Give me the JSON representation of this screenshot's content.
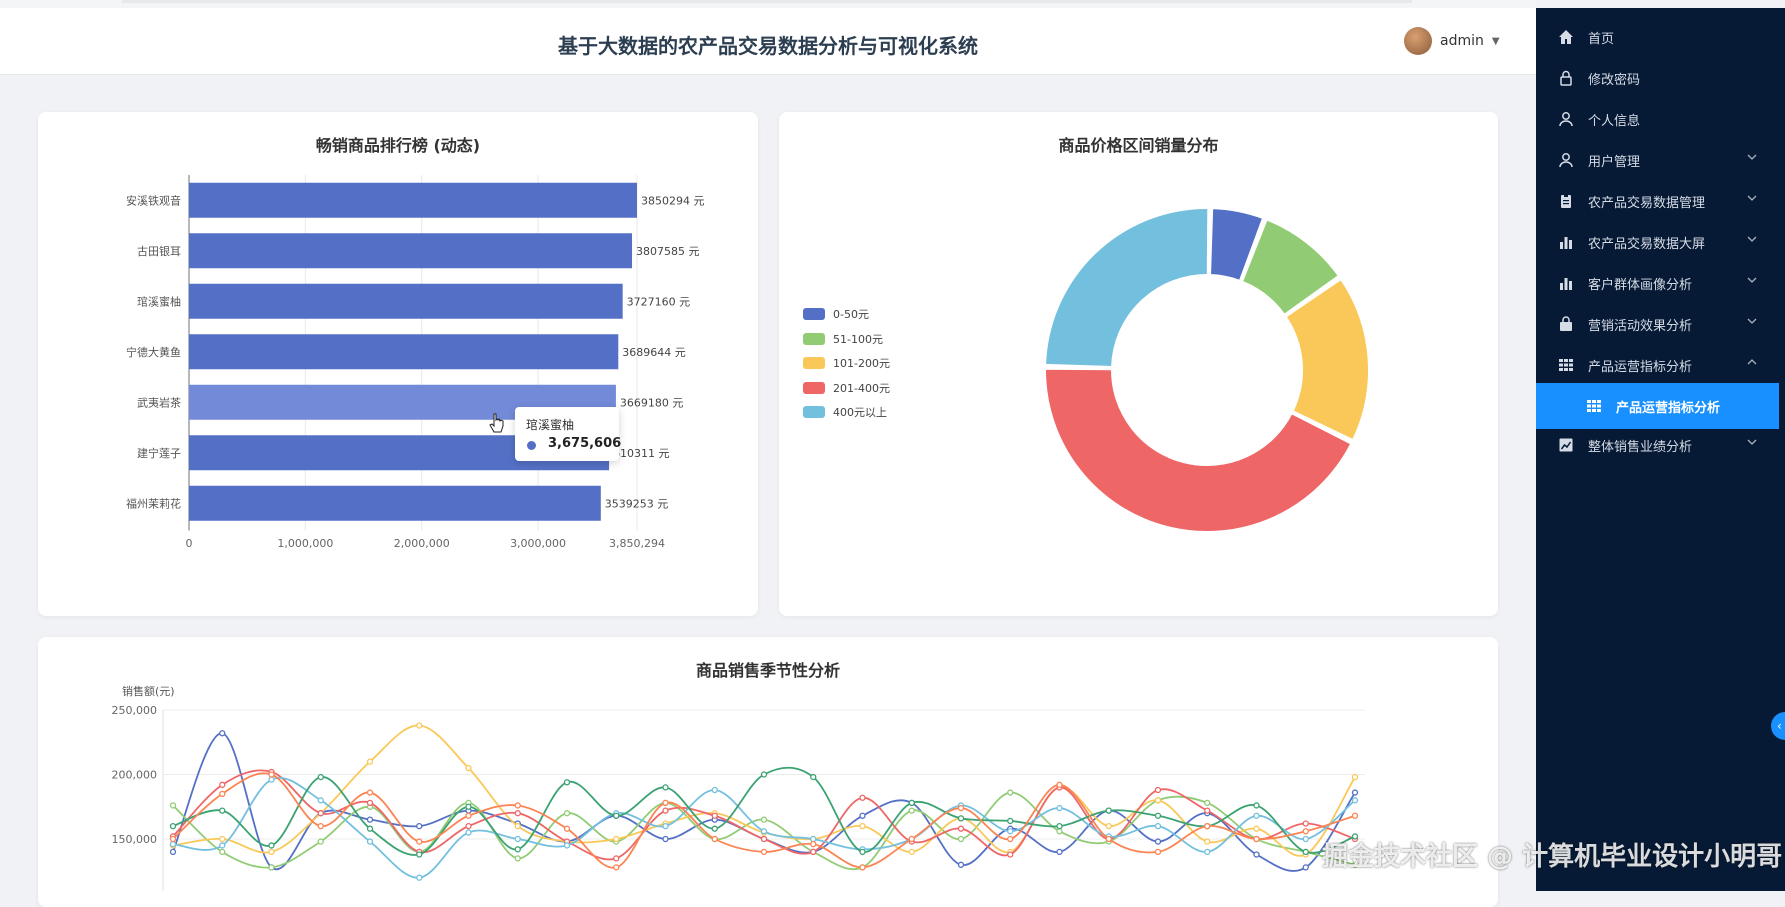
{
  "header": {
    "title": "基于大数据的农产品交易数据分析与可视化系统",
    "user": "admin"
  },
  "sidebar": {
    "items": [
      {
        "label": "首页",
        "icon": "home-icon",
        "arrow": ""
      },
      {
        "label": "修改密码",
        "icon": "lock-icon",
        "arrow": ""
      },
      {
        "label": "个人信息",
        "icon": "user-icon",
        "arrow": ""
      },
      {
        "label": "用户管理",
        "icon": "user-icon",
        "arrow": "chevron-down"
      },
      {
        "label": "农产品交易数据管理",
        "icon": "clipboard-icon",
        "arrow": "chevron-down"
      },
      {
        "label": "农产品交易数据大屏",
        "icon": "bar-chart-icon",
        "arrow": "chevron-down"
      },
      {
        "label": "客户群体画像分析",
        "icon": "bar-chart-icon",
        "arrow": "chevron-down"
      },
      {
        "label": "营销活动效果分析",
        "icon": "bag-icon",
        "arrow": "chevron-down"
      },
      {
        "label": "产品运营指标分析",
        "icon": "grid-icon",
        "arrow": "chevron-up"
      },
      {
        "label": "产品运营指标分析",
        "icon": "grid-icon",
        "arrow": "",
        "active": true,
        "sub": true
      },
      {
        "label": "整体销售业绩分析",
        "icon": "line-chart-icon",
        "arrow": "chevron-down"
      }
    ],
    "active_color": "#1890ff",
    "bg_color": "#071a35"
  },
  "charts": {
    "bar": {
      "title": "畅销商品排行榜 (动态)",
      "unit_suffix": " 元",
      "tooltip": {
        "name": "琯溪蜜柚",
        "value": "3,675,606"
      }
    },
    "pie": {
      "title": "商品价格区间销量分布"
    },
    "line": {
      "title": "商品销售季节性分析",
      "ylabel": "销售额(元)"
    }
  },
  "chart_data": [
    {
      "type": "bar",
      "orientation": "horizontal",
      "categories": [
        "安溪铁观音",
        "古田银耳",
        "琯溪蜜柚",
        "宁德大黄鱼",
        "武夷岩茶",
        "建宁莲子",
        "福州茉莉花"
      ],
      "values": [
        3850294,
        3807585,
        3727160,
        3689644,
        3669180,
        3610311,
        3539253
      ],
      "value_labels": [
        "3850294 元",
        "3807585 元",
        "3727160 元",
        "3689644 元",
        "3669180 元",
        "610311 元",
        "3539253 元"
      ],
      "xticks": [
        "0",
        "1,000,000",
        "2,000,000",
        "3,000,000",
        "3,850,294"
      ],
      "xlim": [
        0,
        3850294
      ],
      "highlighted_index": 4,
      "color": "#5470c6",
      "highlight_color": "#738ad8",
      "grid": true
    },
    {
      "type": "pie",
      "variant": "donut",
      "legend_position": "left",
      "slices": [
        {
          "name": "0-50元",
          "value": 5.5,
          "color": "#5470c6"
        },
        {
          "name": "51-100元",
          "value": 9.5,
          "color": "#91cc75"
        },
        {
          "name": "101-200元",
          "value": 17,
          "color": "#fac858"
        },
        {
          "name": "201-400元",
          "value": 43,
          "color": "#ee6666"
        },
        {
          "name": "400元以上",
          "value": 25,
          "color": "#73c0de"
        }
      ]
    },
    {
      "type": "line",
      "smooth": true,
      "yticks": [
        "250,000",
        "200,000",
        "150,000"
      ],
      "ylim": [
        100000,
        250000
      ],
      "grid": true,
      "series": [
        {
          "color": "#5470c6",
          "values": [
            140000,
            232000,
            128000,
            170000,
            165000,
            160000,
            172000,
            162000,
            148000,
            168000,
            150000,
            165000,
            150000,
            140000,
            168000,
            178000,
            130000,
            158000,
            140000,
            172000,
            148000,
            170000,
            138000,
            128000,
            186000
          ]
        },
        {
          "color": "#91cc75",
          "values": [
            176000,
            140000,
            128000,
            148000,
            175000,
            140000,
            178000,
            135000,
            170000,
            148000,
            178000,
            150000,
            165000,
            140000,
            128000,
            172000,
            150000,
            186000,
            156000,
            148000,
            180000,
            178000,
            150000,
            140000,
            130000
          ]
        },
        {
          "color": "#fac858",
          "values": [
            145000,
            150000,
            140000,
            170000,
            210000,
            238000,
            205000,
            160000,
            148000,
            150000,
            162000,
            170000,
            155000,
            150000,
            160000,
            140000,
            166000,
            140000,
            190000,
            160000,
            180000,
            148000,
            158000,
            138000,
            198000
          ]
        },
        {
          "color": "#ee6666",
          "values": [
            152000,
            192000,
            202000,
            170000,
            178000,
            140000,
            160000,
            170000,
            148000,
            135000,
            172000,
            168000,
            150000,
            140000,
            182000,
            148000,
            158000,
            138000,
            190000,
            150000,
            188000,
            172000,
            150000,
            162000,
            150000
          ]
        },
        {
          "color": "#73c0de",
          "values": [
            146000,
            145000,
            196000,
            180000,
            148000,
            120000,
            155000,
            150000,
            145000,
            170000,
            160000,
            188000,
            156000,
            150000,
            142000,
            150000,
            176000,
            156000,
            174000,
            152000,
            160000,
            140000,
            168000,
            150000,
            180000
          ]
        },
        {
          "color": "#3ba272",
          "values": [
            160000,
            172000,
            145000,
            198000,
            158000,
            138000,
            175000,
            142000,
            194000,
            168000,
            190000,
            158000,
            200000,
            198000,
            140000,
            178000,
            166000,
            164000,
            160000,
            172000,
            168000,
            160000,
            176000,
            140000,
            152000
          ]
        },
        {
          "color": "#fc8452",
          "values": [
            150000,
            185000,
            200000,
            160000,
            186000,
            148000,
            168000,
            176000,
            158000,
            128000,
            178000,
            150000,
            140000,
            146000,
            128000,
            150000,
            174000,
            150000,
            192000,
            150000,
            140000,
            160000,
            150000,
            156000,
            168000
          ]
        }
      ]
    }
  ],
  "watermark": "掘金技术社区 @ 计算机毕业设计小明哥"
}
